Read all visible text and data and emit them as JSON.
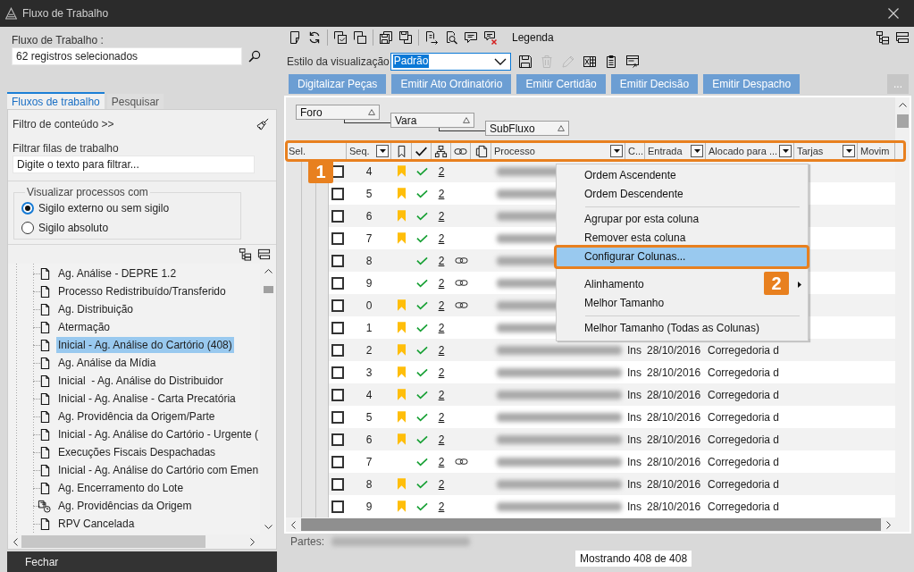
{
  "window": {
    "title": "Fluxo de Trabalho"
  },
  "left_panel": {
    "workflow_label": "Fluxo de Trabalho :",
    "workflow_field": {
      "value": "62 registros selecionados"
    },
    "tabs": [
      {
        "label": "Fluxos de trabalho",
        "selected": true
      },
      {
        "label": "Pesquisar",
        "selected": false
      }
    ],
    "content_filter_toggle": "Filtro de conteúdo >>",
    "queue_filter": {
      "label": "Filtrar filas de trabalho",
      "placeholder": "Digite o texto para filtrar..."
    },
    "visibility": {
      "title": "Visualizar processos com",
      "options": [
        {
          "label": "Sigilo externo ou sem sigilo",
          "selected": true
        },
        {
          "label": "Sigilo absoluto",
          "selected": false
        }
      ]
    },
    "tree": {
      "items": [
        {
          "label": "Ag. Análise - DEPRE 1.2",
          "kind": "queue",
          "selected": false
        },
        {
          "label": "Processo Redistribuído/Transferido",
          "kind": "queue",
          "selected": false
        },
        {
          "label": "Ag. Distribuição",
          "kind": "queue",
          "selected": false
        },
        {
          "label": "Atermação",
          "kind": "queue",
          "selected": false
        },
        {
          "label": "Inicial - Ag. Análise do Cartório (408)",
          "kind": "queue",
          "selected": true
        },
        {
          "label": "Ag. Análise da Mídia",
          "kind": "queue",
          "selected": false
        },
        {
          "label": "Inicial  - Ag. Análise do Distribuidor",
          "kind": "queue",
          "selected": false
        },
        {
          "label": "Inicial - Ag. Analise - Carta Precatória",
          "kind": "queue",
          "selected": false
        },
        {
          "label": "Ag. Providência da Origem/Parte",
          "kind": "queue",
          "selected": false
        },
        {
          "label": "Inicial - Ag. Análise do Cartório - Urgente (",
          "kind": "queue",
          "selected": false
        },
        {
          "label": "Execuções Fiscais Despachadas",
          "kind": "queue",
          "selected": false
        },
        {
          "label": "Inicial - Ag. Análise do Cartório com Emen",
          "kind": "queue",
          "selected": false
        },
        {
          "label": "Ag. Encerramento do Lote",
          "kind": "queue",
          "selected": false
        },
        {
          "label": "Ag. Providências da Origem",
          "kind": "timed",
          "selected": false
        },
        {
          "label": "RPV Cancelada",
          "kind": "queue",
          "selected": false
        }
      ]
    },
    "close_button": "Fechar"
  },
  "toolbar": {
    "legend_button": "Legenda"
  },
  "view_style": {
    "label": "Estilo da visualização",
    "value": "Padrão",
    "focused": true,
    "tools": [
      {
        "kind": "save",
        "disabled": false
      },
      {
        "kind": "delete",
        "disabled": true
      },
      {
        "kind": "edit",
        "disabled": true
      },
      {
        "kind": "spreadsheet",
        "disabled": false
      },
      {
        "kind": "list",
        "disabled": false
      },
      {
        "kind": "export",
        "disabled": false
      }
    ]
  },
  "action_buttons": [
    "Digitalizar Peças",
    "Emitir Ato Ordinatório",
    "Emitir Certidão",
    "Emitir Decisão",
    "Emitir Despacho"
  ],
  "more_button": "...",
  "grid": {
    "group_by": [
      {
        "label": "Foro",
        "ascending": true
      },
      {
        "label": "Vara",
        "ascending": true
      },
      {
        "label": "SubFluxo",
        "ascending": true
      }
    ],
    "header": {
      "callout": "1",
      "columns": [
        {
          "kind": "text",
          "label": "Sel.",
          "dropdown": false
        },
        {
          "kind": "text",
          "label": "Seq.",
          "dropdown": true
        },
        {
          "kind": "bookmark"
        },
        {
          "kind": "check"
        },
        {
          "kind": "hierarchy"
        },
        {
          "kind": "link"
        },
        {
          "kind": "document"
        },
        {
          "kind": "text",
          "label": "Processo",
          "dropdown": true
        },
        {
          "kind": "text",
          "label": "C...",
          "dropdown": false
        },
        {
          "kind": "text",
          "label": "Entrada",
          "dropdown": true
        },
        {
          "kind": "text",
          "label": "Alocado para ...",
          "dropdown": true
        },
        {
          "kind": "text",
          "label": "Tarjas",
          "dropdown": true
        },
        {
          "kind": "text",
          "label": "Movim",
          "dropdown": false
        }
      ]
    },
    "rows": [
      {
        "seq": "4",
        "checked": false,
        "bookmarked": true,
        "verified": true,
        "column_5": "2",
        "linked": false
      },
      {
        "seq": "5",
        "checked": false,
        "bookmarked": true,
        "verified": true,
        "column_5": "2",
        "linked": false
      },
      {
        "seq": "6",
        "checked": false,
        "bookmarked": true,
        "verified": true,
        "column_5": "2",
        "linked": false
      },
      {
        "seq": "7",
        "checked": false,
        "bookmarked": true,
        "verified": true,
        "column_5": "2",
        "linked": false
      },
      {
        "seq": "8",
        "checked": false,
        "bookmarked": false,
        "verified": true,
        "column_5": "2",
        "linked": true
      },
      {
        "seq": "9",
        "checked": false,
        "bookmarked": false,
        "verified": true,
        "column_5": "2",
        "linked": true
      },
      {
        "seq": "0",
        "checked": false,
        "bookmarked": true,
        "verified": true,
        "column_5": "2",
        "linked": true
      },
      {
        "seq": "1",
        "checked": false,
        "bookmarked": true,
        "verified": true,
        "column_5": "2",
        "linked": false
      },
      {
        "seq": "2",
        "checked": false,
        "bookmarked": true,
        "verified": true,
        "column_5": "2",
        "linked": false,
        "column_9": "Ins",
        "entrada": "28/10/2016",
        "alocado_para": "Corregedoria d"
      },
      {
        "seq": "3",
        "checked": false,
        "bookmarked": true,
        "verified": true,
        "column_5": "2",
        "linked": false,
        "column_9": "Ins",
        "entrada": "28/10/2016",
        "alocado_para": "Corregedoria d"
      },
      {
        "seq": "4",
        "checked": false,
        "bookmarked": true,
        "verified": true,
        "column_5": "2",
        "linked": false,
        "column_9": "Ins",
        "entrada": "28/10/2016",
        "alocado_para": "Corregedoria d"
      },
      {
        "seq": "5",
        "checked": false,
        "bookmarked": true,
        "verified": true,
        "column_5": "2",
        "linked": false,
        "column_9": "Ins",
        "entrada": "28/10/2016",
        "alocado_para": "Corregedoria d"
      },
      {
        "seq": "6",
        "checked": false,
        "bookmarked": true,
        "verified": true,
        "column_5": "2",
        "linked": false,
        "column_9": "Ins",
        "entrada": "28/10/2016",
        "alocado_para": "Corregedoria d"
      },
      {
        "seq": "7",
        "checked": false,
        "bookmarked": false,
        "verified": true,
        "column_5": "2",
        "linked": true,
        "column_9": "Ins",
        "entrada": "28/10/2016",
        "alocado_para": "Corregedoria d"
      },
      {
        "seq": "8",
        "checked": false,
        "bookmarked": true,
        "verified": true,
        "column_5": "2",
        "linked": false,
        "column_9": "Ins",
        "entrada": "28/10/2016",
        "alocado_para": "Corregedoria d"
      },
      {
        "seq": "9",
        "checked": false,
        "bookmarked": true,
        "verified": true,
        "column_5": "2",
        "linked": false,
        "column_9": "Ins",
        "entrada": "28/10/2016",
        "alocado_para": "Corregedoria d"
      }
    ],
    "context_menu": {
      "items": [
        {
          "kind": "item",
          "label": "Ordem Ascendente",
          "selected": false,
          "submenu": false
        },
        {
          "kind": "item",
          "label": "Ordem Descendente",
          "selected": false,
          "submenu": false
        },
        {
          "kind": "separator"
        },
        {
          "kind": "item",
          "label": "Agrupar por esta coluna",
          "selected": false,
          "submenu": false
        },
        {
          "kind": "item",
          "label": "Remover esta coluna",
          "selected": false,
          "submenu": false
        },
        {
          "kind": "item",
          "label": "Configurar Colunas...",
          "selected": true,
          "submenu": false,
          "callout": "2"
        },
        {
          "kind": "item",
          "label": "Alinhamento",
          "selected": false,
          "submenu": true
        },
        {
          "kind": "item",
          "label": "Melhor Tamanho",
          "selected": false,
          "submenu": false
        },
        {
          "kind": "separator"
        },
        {
          "kind": "item",
          "label": "Melhor Tamanho (Todas as Colunas)",
          "selected": false,
          "submenu": false
        }
      ]
    }
  },
  "footer": {
    "parts_label": "Partes:",
    "status": "Mostrando 408 de 408"
  }
}
